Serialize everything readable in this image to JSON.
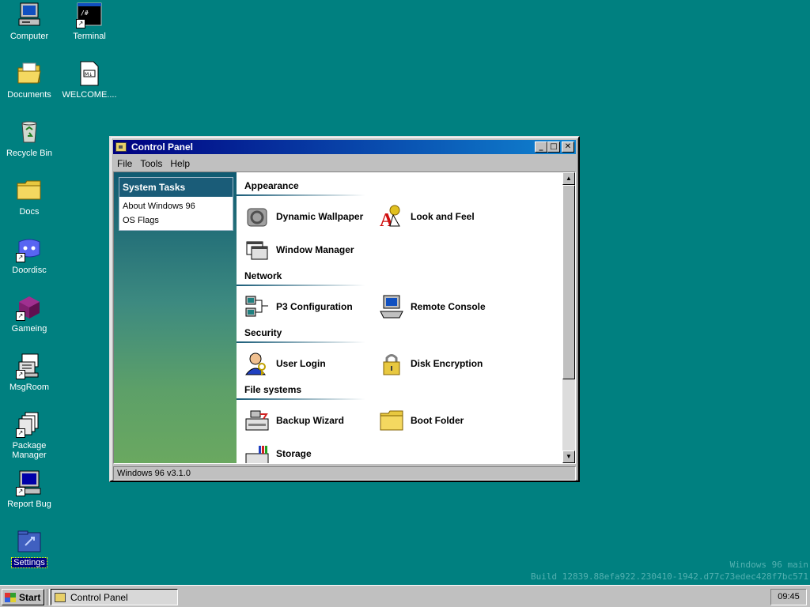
{
  "desktop": {
    "icons": [
      {
        "label": "Computer",
        "icon": "computer-icon"
      },
      {
        "label": "Terminal",
        "icon": "terminal-icon"
      },
      {
        "label": "Documents",
        "icon": "documents-folder-icon"
      },
      {
        "label": "WELCOME....",
        "icon": "markdown-file-icon"
      },
      {
        "label": "Recycle Bin",
        "icon": "recycle-bin-icon"
      },
      {
        "label": "Docs",
        "icon": "folder-icon"
      },
      {
        "label": "Doordisc",
        "icon": "doordisc-icon"
      },
      {
        "label": "Gameing",
        "icon": "cube-icon"
      },
      {
        "label": "MsgRoom",
        "icon": "msgroom-icon"
      },
      {
        "label": "Package Manager",
        "icon": "package-manager-icon"
      },
      {
        "label": "Report Bug",
        "icon": "report-bug-icon"
      },
      {
        "label": "Settings",
        "icon": "settings-icon"
      }
    ],
    "terminal_glyph": "/#",
    "markdown_glyph": "M↓"
  },
  "window": {
    "title": "Control Panel",
    "buttons": {
      "minimize": "_",
      "maximize": "□",
      "close": "✕"
    },
    "menu": [
      "File",
      "Tools",
      "Help"
    ],
    "tasks": {
      "title": "System Tasks",
      "items": [
        "About Windows 96",
        "OS Flags"
      ]
    },
    "sections": [
      {
        "title": "Appearance",
        "items": [
          "Dynamic Wallpaper",
          "Look and Feel",
          "Window Manager"
        ]
      },
      {
        "title": "Network",
        "items": [
          "P3 Configuration",
          "Remote Console"
        ]
      },
      {
        "title": "Security",
        "items": [
          "User Login",
          "Disk Encryption"
        ]
      },
      {
        "title": "File systems",
        "items": [
          "Backup Wizard",
          "Boot Folder",
          "Storage"
        ]
      }
    ],
    "status": "Windows 96 v3.1.0",
    "scroll_arrows": {
      "up": "▲",
      "down": "▼"
    }
  },
  "build": {
    "line1": "Windows 96 main",
    "line2": "Build 12839.88efa922.230410-1942.d77c73edec428f7bc571"
  },
  "taskbar": {
    "start": "Start",
    "task": "Control Panel",
    "clock": "09:45"
  },
  "colors": {
    "desktop": "#008080",
    "titlebar_start": "#000080",
    "titlebar_end": "#1084d0",
    "panel_head": "#1a5c78"
  }
}
